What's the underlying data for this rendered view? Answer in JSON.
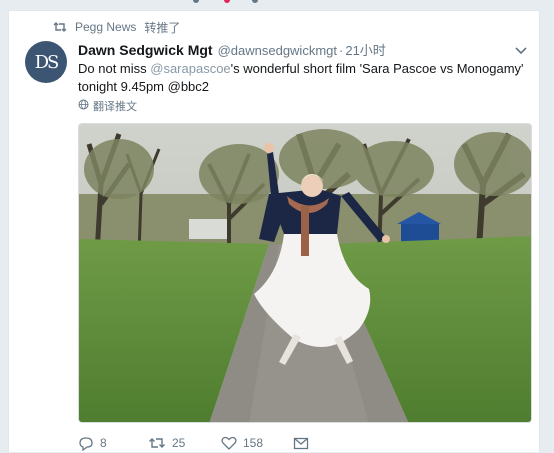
{
  "retweet": {
    "icon": "retweet-icon",
    "user": "Pegg News",
    "action": "转推了"
  },
  "tweet": {
    "avatar_text": "DS",
    "display_name": "Dawn Sedgwick Mgt",
    "handle": "@dawnsedgwickmgt",
    "separator": "·",
    "timestamp": "21小时",
    "text": {
      "part1": "Do not miss ",
      "mention1": "@sarapascoe",
      "part2": "'s wonderful short film 'Sara Pascoe vs Monogamy' tonight 9.45pm ",
      "mention2": "@bbc2"
    },
    "translate_label": "翻译推文",
    "media_description_icon": "photo-icon"
  },
  "actions": {
    "reply_count": "8",
    "retweet_count": "25",
    "like_count": "158"
  },
  "colors": {
    "accent_gray": "#657786",
    "mention": "#8899a6",
    "avatar_bg": "#3b5572",
    "grass": "#5c8a3a",
    "path": "#8f8c86"
  }
}
